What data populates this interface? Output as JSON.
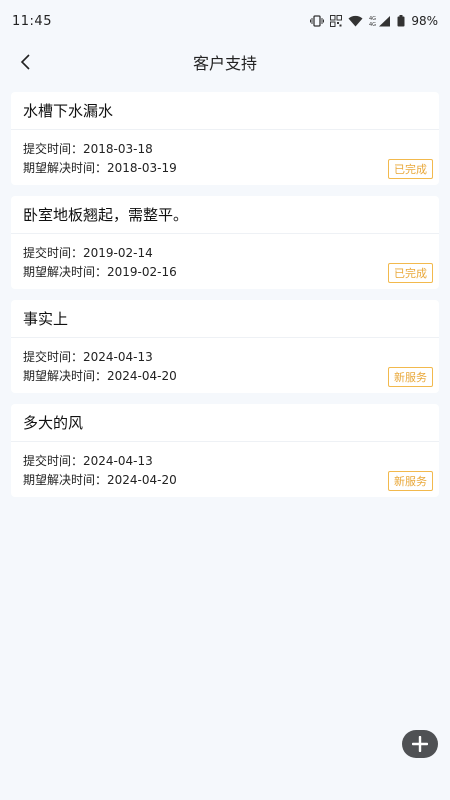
{
  "status": {
    "time": "11:45",
    "battery": "98%"
  },
  "nav": {
    "title": "客户支持"
  },
  "tickets": [
    {
      "title": "水槽下水漏水",
      "submit_label": "提交时间：",
      "submit_date": "2018-03-18",
      "expect_label": "期望解决时间：",
      "expect_date": "2018-03-19",
      "status": "已完成"
    },
    {
      "title": "卧室地板翘起，需整平。",
      "submit_label": "提交时间：",
      "submit_date": "2019-02-14",
      "expect_label": "期望解决时间：",
      "expect_date": "2019-02-16",
      "status": "已完成"
    },
    {
      "title": "事实上",
      "submit_label": "提交时间：",
      "submit_date": "2024-04-13",
      "expect_label": "期望解决时间：",
      "expect_date": "2024-04-20",
      "status": "新服务"
    },
    {
      "title": "多大的风",
      "submit_label": "提交时间：",
      "submit_date": "2024-04-13",
      "expect_label": "期望解决时间：",
      "expect_date": "2024-04-20",
      "status": "新服务"
    }
  ],
  "icons": {
    "back": "chevron-left-icon",
    "fab": "plus-icon"
  },
  "colors": {
    "badge": "#e9a83a",
    "fab": "#4f5154",
    "background": "#f5f8fc"
  }
}
